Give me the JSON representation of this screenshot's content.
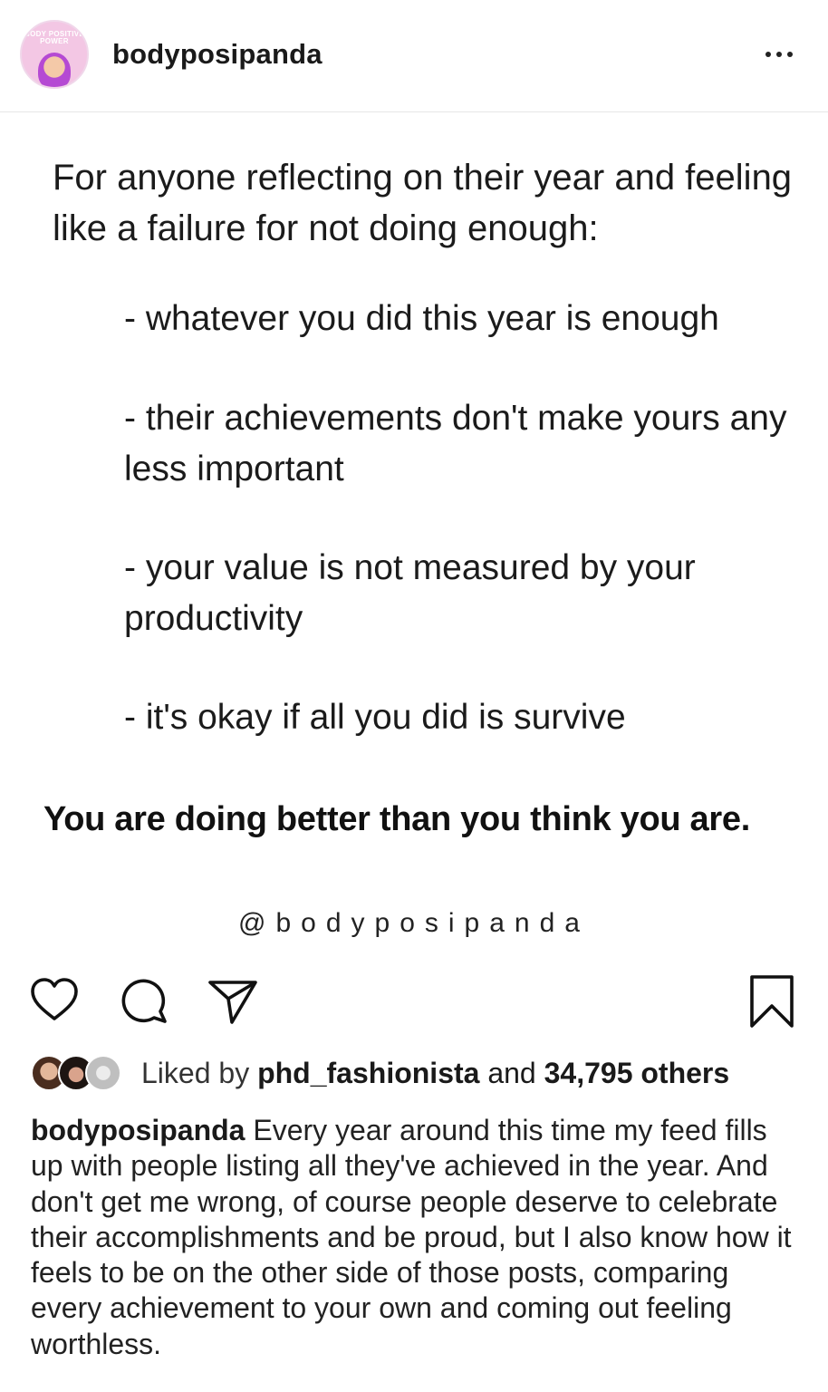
{
  "header": {
    "avatar_text": "BODY POSITIVE POWER",
    "username": "bodyposipanda",
    "more_icon": "more-horizontal-icon"
  },
  "post": {
    "intro": "For anyone reflecting on their year and feeling like a failure for not doing enough:",
    "bullets": [
      "- whatever you did this year is enough",
      "- their achievements don't make yours any less important",
      "- your value is not measured by your productivity",
      "- it's okay if all you did is survive"
    ],
    "emphasis": "You are doing better than you think you are.",
    "handle": "@bodyposipanda"
  },
  "actions": {
    "icons": [
      "heart-icon",
      "comment-icon",
      "share-icon",
      "bookmark-icon"
    ]
  },
  "likes": {
    "prefix": "Liked by",
    "user": "phd_fashionista",
    "connector": "and",
    "others": "34,795 others"
  },
  "caption": {
    "user": "bodyposipanda",
    "text": "Every year around this time my feed fills up with people listing all they've achieved in the year. And don't get me wrong, of course people deserve to celebrate their accomplishments and be proud, but I also know how it feels to be on the other side of those posts, comparing every achievement to your own and coming out feeling worthless."
  },
  "colors": {
    "background": "#ffffff",
    "text": "#1a1a1a",
    "avatar_ring": "#f3c7e4",
    "divider": "#e6e6e6"
  }
}
